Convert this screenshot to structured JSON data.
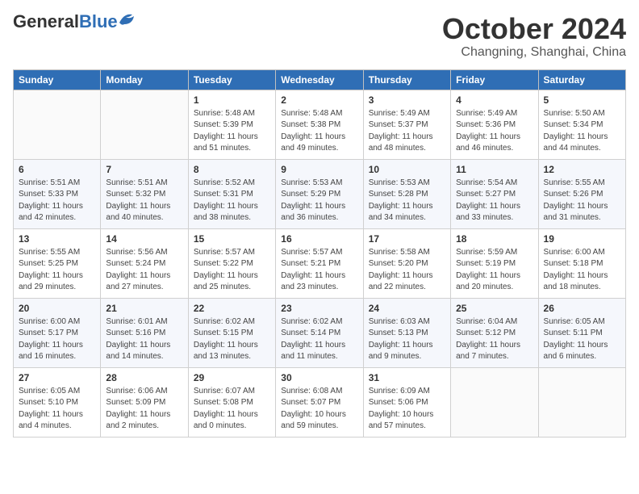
{
  "header": {
    "logo_general": "General",
    "logo_blue": "Blue",
    "month_title": "October 2024",
    "location": "Changning, Shanghai, China"
  },
  "weekdays": [
    "Sunday",
    "Monday",
    "Tuesday",
    "Wednesday",
    "Thursday",
    "Friday",
    "Saturday"
  ],
  "weeks": [
    [
      {
        "day": "",
        "info": ""
      },
      {
        "day": "",
        "info": ""
      },
      {
        "day": "1",
        "info": "Sunrise: 5:48 AM\nSunset: 5:39 PM\nDaylight: 11 hours and 51 minutes."
      },
      {
        "day": "2",
        "info": "Sunrise: 5:48 AM\nSunset: 5:38 PM\nDaylight: 11 hours and 49 minutes."
      },
      {
        "day": "3",
        "info": "Sunrise: 5:49 AM\nSunset: 5:37 PM\nDaylight: 11 hours and 48 minutes."
      },
      {
        "day": "4",
        "info": "Sunrise: 5:49 AM\nSunset: 5:36 PM\nDaylight: 11 hours and 46 minutes."
      },
      {
        "day": "5",
        "info": "Sunrise: 5:50 AM\nSunset: 5:34 PM\nDaylight: 11 hours and 44 minutes."
      }
    ],
    [
      {
        "day": "6",
        "info": "Sunrise: 5:51 AM\nSunset: 5:33 PM\nDaylight: 11 hours and 42 minutes."
      },
      {
        "day": "7",
        "info": "Sunrise: 5:51 AM\nSunset: 5:32 PM\nDaylight: 11 hours and 40 minutes."
      },
      {
        "day": "8",
        "info": "Sunrise: 5:52 AM\nSunset: 5:31 PM\nDaylight: 11 hours and 38 minutes."
      },
      {
        "day": "9",
        "info": "Sunrise: 5:53 AM\nSunset: 5:29 PM\nDaylight: 11 hours and 36 minutes."
      },
      {
        "day": "10",
        "info": "Sunrise: 5:53 AM\nSunset: 5:28 PM\nDaylight: 11 hours and 34 minutes."
      },
      {
        "day": "11",
        "info": "Sunrise: 5:54 AM\nSunset: 5:27 PM\nDaylight: 11 hours and 33 minutes."
      },
      {
        "day": "12",
        "info": "Sunrise: 5:55 AM\nSunset: 5:26 PM\nDaylight: 11 hours and 31 minutes."
      }
    ],
    [
      {
        "day": "13",
        "info": "Sunrise: 5:55 AM\nSunset: 5:25 PM\nDaylight: 11 hours and 29 minutes."
      },
      {
        "day": "14",
        "info": "Sunrise: 5:56 AM\nSunset: 5:24 PM\nDaylight: 11 hours and 27 minutes."
      },
      {
        "day": "15",
        "info": "Sunrise: 5:57 AM\nSunset: 5:22 PM\nDaylight: 11 hours and 25 minutes."
      },
      {
        "day": "16",
        "info": "Sunrise: 5:57 AM\nSunset: 5:21 PM\nDaylight: 11 hours and 23 minutes."
      },
      {
        "day": "17",
        "info": "Sunrise: 5:58 AM\nSunset: 5:20 PM\nDaylight: 11 hours and 22 minutes."
      },
      {
        "day": "18",
        "info": "Sunrise: 5:59 AM\nSunset: 5:19 PM\nDaylight: 11 hours and 20 minutes."
      },
      {
        "day": "19",
        "info": "Sunrise: 6:00 AM\nSunset: 5:18 PM\nDaylight: 11 hours and 18 minutes."
      }
    ],
    [
      {
        "day": "20",
        "info": "Sunrise: 6:00 AM\nSunset: 5:17 PM\nDaylight: 11 hours and 16 minutes."
      },
      {
        "day": "21",
        "info": "Sunrise: 6:01 AM\nSunset: 5:16 PM\nDaylight: 11 hours and 14 minutes."
      },
      {
        "day": "22",
        "info": "Sunrise: 6:02 AM\nSunset: 5:15 PM\nDaylight: 11 hours and 13 minutes."
      },
      {
        "day": "23",
        "info": "Sunrise: 6:02 AM\nSunset: 5:14 PM\nDaylight: 11 hours and 11 minutes."
      },
      {
        "day": "24",
        "info": "Sunrise: 6:03 AM\nSunset: 5:13 PM\nDaylight: 11 hours and 9 minutes."
      },
      {
        "day": "25",
        "info": "Sunrise: 6:04 AM\nSunset: 5:12 PM\nDaylight: 11 hours and 7 minutes."
      },
      {
        "day": "26",
        "info": "Sunrise: 6:05 AM\nSunset: 5:11 PM\nDaylight: 11 hours and 6 minutes."
      }
    ],
    [
      {
        "day": "27",
        "info": "Sunrise: 6:05 AM\nSunset: 5:10 PM\nDaylight: 11 hours and 4 minutes."
      },
      {
        "day": "28",
        "info": "Sunrise: 6:06 AM\nSunset: 5:09 PM\nDaylight: 11 hours and 2 minutes."
      },
      {
        "day": "29",
        "info": "Sunrise: 6:07 AM\nSunset: 5:08 PM\nDaylight: 11 hours and 0 minutes."
      },
      {
        "day": "30",
        "info": "Sunrise: 6:08 AM\nSunset: 5:07 PM\nDaylight: 10 hours and 59 minutes."
      },
      {
        "day": "31",
        "info": "Sunrise: 6:09 AM\nSunset: 5:06 PM\nDaylight: 10 hours and 57 minutes."
      },
      {
        "day": "",
        "info": ""
      },
      {
        "day": "",
        "info": ""
      }
    ]
  ]
}
